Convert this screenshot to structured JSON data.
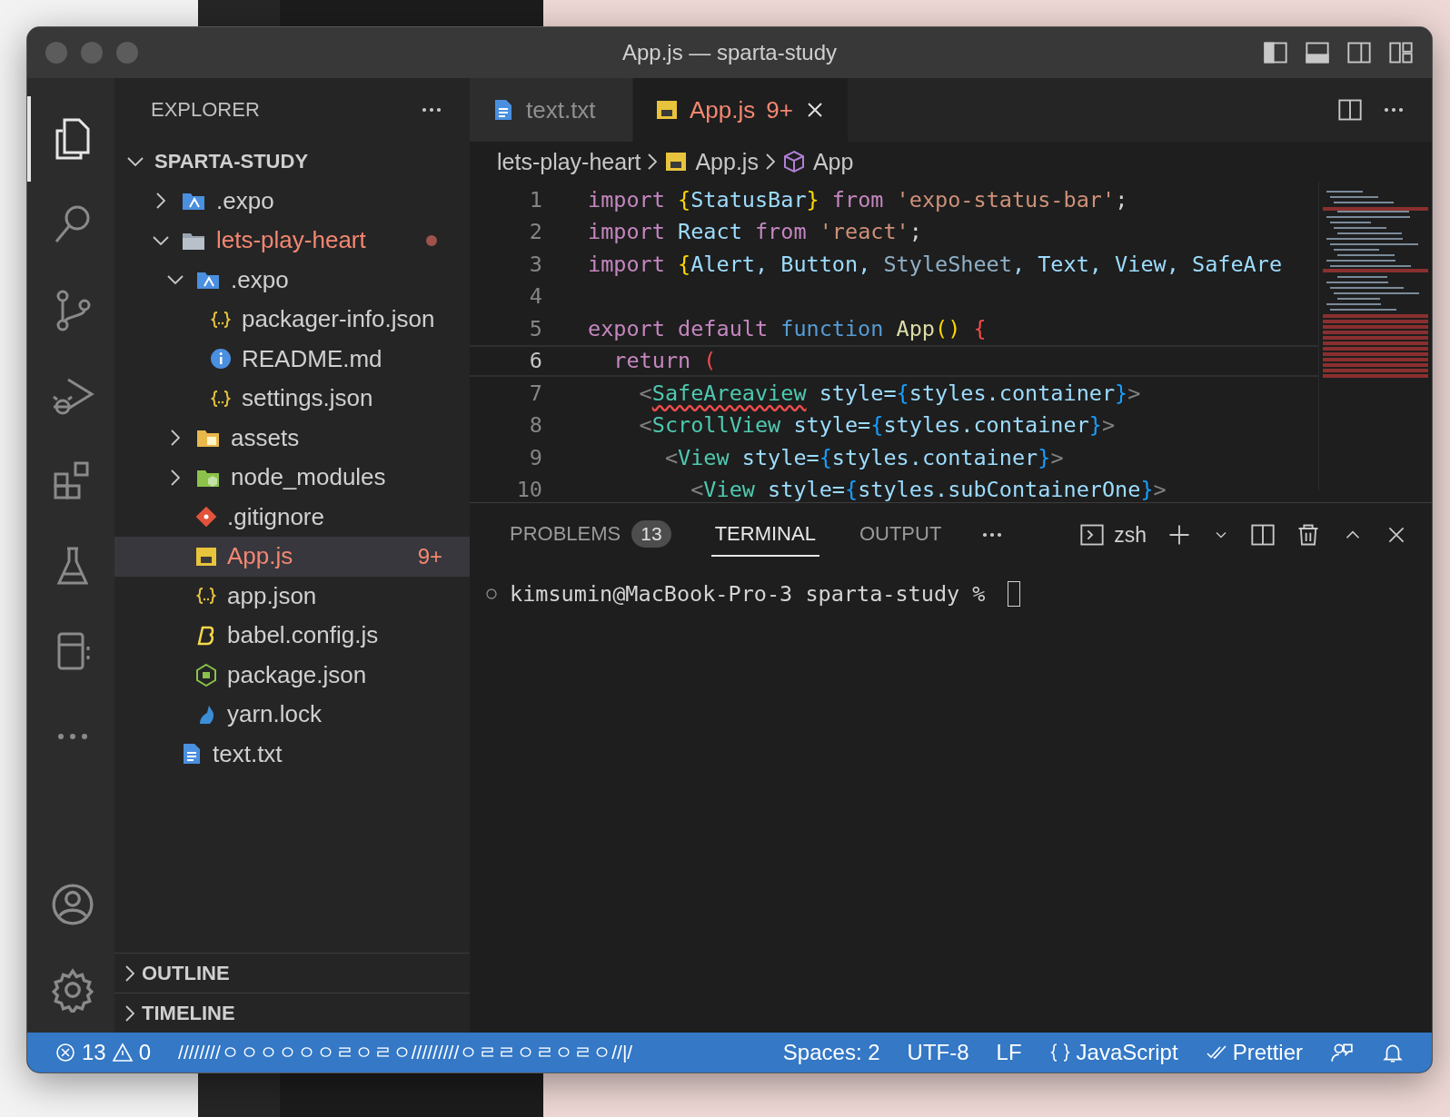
{
  "window": {
    "title": "App.js — sparta-study"
  },
  "activity_bar": [
    {
      "kind": "explorer",
      "selected": true
    },
    {
      "kind": "search",
      "selected": false
    },
    {
      "kind": "source-control",
      "selected": false
    },
    {
      "kind": "run",
      "selected": false
    },
    {
      "kind": "extensions",
      "selected": false
    },
    {
      "kind": "testing",
      "selected": false
    },
    {
      "kind": "notes",
      "selected": false
    },
    {
      "kind": "more",
      "selected": false
    }
  ],
  "sidebar": {
    "title": "EXPLORER",
    "root": {
      "label": "SPARTA-STUDY",
      "expanded": true
    },
    "tree": [
      {
        "label": ".expo",
        "kind": "folder-expo",
        "expanded": false,
        "selected": false,
        "error": false
      },
      {
        "label": "lets-play-heart",
        "kind": "folder",
        "expanded": true,
        "selected": false,
        "error": true,
        "children": [
          {
            "label": ".expo",
            "kind": "folder-expo",
            "expanded": true,
            "selected": false,
            "error": false,
            "children": [
              {
                "label": "packager-info.json",
                "kind": "json",
                "selected": false,
                "error": false
              },
              {
                "label": "README.md",
                "kind": "info",
                "selected": false,
                "error": false
              },
              {
                "label": "settings.json",
                "kind": "json",
                "selected": false,
                "error": false
              }
            ]
          },
          {
            "label": "assets",
            "kind": "folder-assets",
            "expanded": false,
            "selected": false,
            "error": false
          },
          {
            "label": "node_modules",
            "kind": "folder-node",
            "expanded": false,
            "selected": false,
            "error": false
          },
          {
            "label": ".gitignore",
            "kind": "git",
            "selected": false,
            "error": false
          },
          {
            "label": "App.js",
            "kind": "js",
            "selected": true,
            "error": true,
            "badge": "9+"
          },
          {
            "label": "app.json",
            "kind": "json",
            "selected": false,
            "error": false
          },
          {
            "label": "babel.config.js",
            "kind": "babel",
            "selected": false,
            "error": false
          },
          {
            "label": "package.json",
            "kind": "node",
            "selected": false,
            "error": false
          },
          {
            "label": "yarn.lock",
            "kind": "yarn",
            "selected": false,
            "error": false
          }
        ]
      },
      {
        "label": "text.txt",
        "kind": "text",
        "selected": false,
        "error": false
      }
    ],
    "sections": [
      {
        "label": "OUTLINE",
        "expanded": false
      },
      {
        "label": "TIMELINE",
        "expanded": false
      }
    ]
  },
  "tabs": [
    {
      "label": "text.txt",
      "kind": "text",
      "selected": false
    },
    {
      "label": "App.js",
      "kind": "js",
      "selected": true,
      "badge": "9+"
    }
  ],
  "breadcrumbs": [
    {
      "label": "lets-play-heart",
      "kind": "folder"
    },
    {
      "label": "App.js",
      "kind": "js"
    },
    {
      "label": "App",
      "kind": "symbol"
    }
  ],
  "code": [
    {
      "number": "1",
      "selected": false,
      "tokens": [
        {
          "text": "import ",
          "kind": "kw"
        },
        {
          "text": "{",
          "kind": "b1"
        },
        {
          "text": "StatusBar",
          "kind": "var"
        },
        {
          "text": "}",
          "kind": "b1"
        },
        {
          "text": " from ",
          "kind": "kw"
        },
        {
          "text": "'expo-status-bar'",
          "kind": "str"
        },
        {
          "text": ";",
          "kind": "plain"
        }
      ]
    },
    {
      "number": "2",
      "selected": false,
      "tokens": [
        {
          "text": "import ",
          "kind": "kw"
        },
        {
          "text": "React",
          "kind": "var"
        },
        {
          "text": " from ",
          "kind": "kw"
        },
        {
          "text": "'react'",
          "kind": "str"
        },
        {
          "text": ";",
          "kind": "plain"
        }
      ]
    },
    {
      "number": "3",
      "selected": false,
      "tokens": [
        {
          "text": "import ",
          "kind": "kw"
        },
        {
          "text": "{",
          "kind": "b1"
        },
        {
          "text": "Alert, Button, ",
          "kind": "var"
        },
        {
          "text": "StyleSheet",
          "kind": "cls"
        },
        {
          "text": ", Text, View, SafeAre",
          "kind": "var"
        }
      ]
    },
    {
      "number": "4",
      "selected": false
    },
    {
      "number": "5",
      "selected": false,
      "tokens": [
        {
          "text": "export default ",
          "kind": "kw"
        },
        {
          "text": "function ",
          "kind": "storage"
        },
        {
          "text": "App",
          "kind": "fn"
        },
        {
          "text": "() ",
          "kind": "b1"
        },
        {
          "text": "{",
          "kind": "bad"
        }
      ]
    },
    {
      "number": "6",
      "selected": true,
      "tokens": [
        {
          "text": "  return ",
          "kind": "kw"
        },
        {
          "text": "(",
          "kind": "bad"
        }
      ]
    },
    {
      "number": "7",
      "selected": false,
      "tokens": [
        {
          "text": "    <",
          "kind": "tag"
        },
        {
          "text": "SafeAreaview",
          "kind": "type",
          "error": true
        },
        {
          "text": " style=",
          "kind": "var"
        },
        {
          "text": "{",
          "kind": "b3"
        },
        {
          "text": "styles.container",
          "kind": "var"
        },
        {
          "text": "}",
          "kind": "b3"
        },
        {
          "text": ">",
          "kind": "tag"
        }
      ]
    },
    {
      "number": "8",
      "selected": false,
      "tokens": [
        {
          "text": "    <",
          "kind": "tag"
        },
        {
          "text": "ScrollView",
          "kind": "type"
        },
        {
          "text": " style=",
          "kind": "var"
        },
        {
          "text": "{",
          "kind": "b3"
        },
        {
          "text": "styles.container",
          "kind": "var"
        },
        {
          "text": "}",
          "kind": "b3"
        },
        {
          "text": ">",
          "kind": "tag"
        }
      ]
    },
    {
      "number": "9",
      "selected": false,
      "tokens": [
        {
          "text": "      <",
          "kind": "tag"
        },
        {
          "text": "View",
          "kind": "type"
        },
        {
          "text": " style=",
          "kind": "var"
        },
        {
          "text": "{",
          "kind": "b3"
        },
        {
          "text": "styles.container",
          "kind": "var"
        },
        {
          "text": "}",
          "kind": "b3"
        },
        {
          "text": ">",
          "kind": "tag"
        }
      ]
    },
    {
      "number": "10",
      "selected": false,
      "tokens": [
        {
          "text": "        <",
          "kind": "tag"
        },
        {
          "text": "View",
          "kind": "type"
        },
        {
          "text": " style=",
          "kind": "var"
        },
        {
          "text": "{",
          "kind": "b3"
        },
        {
          "text": "styles.subContainerOne",
          "kind": "var"
        },
        {
          "text": "}",
          "kind": "b3"
        },
        {
          "text": ">",
          "kind": "tag"
        }
      ]
    }
  ],
  "panel": {
    "tabs": [
      {
        "label": "PROBLEMS",
        "selected": false,
        "badge": "13"
      },
      {
        "label": "TERMINAL",
        "selected": true
      },
      {
        "label": "OUTPUT",
        "selected": false
      }
    ],
    "shell": "zsh",
    "terminal_line": "kimsumin@MacBook-Pro-3 sparta-study % "
  },
  "status_bar": {
    "errors": "13",
    "warnings": "0",
    "message": "////////ㅇㅇㅇㅇㅇㅇㄹㅇㄹㅇ/////////ㅇㄹㄹㅇㄹㅇㄹㅇ//|/",
    "items": [
      {
        "label": "Spaces: 2",
        "kind": "text"
      },
      {
        "label": "UTF-8",
        "kind": "text"
      },
      {
        "label": "LF",
        "kind": "text"
      },
      {
        "label": "JavaScript",
        "kind": "language"
      },
      {
        "label": "Prettier",
        "kind": "formatter"
      }
    ]
  }
}
